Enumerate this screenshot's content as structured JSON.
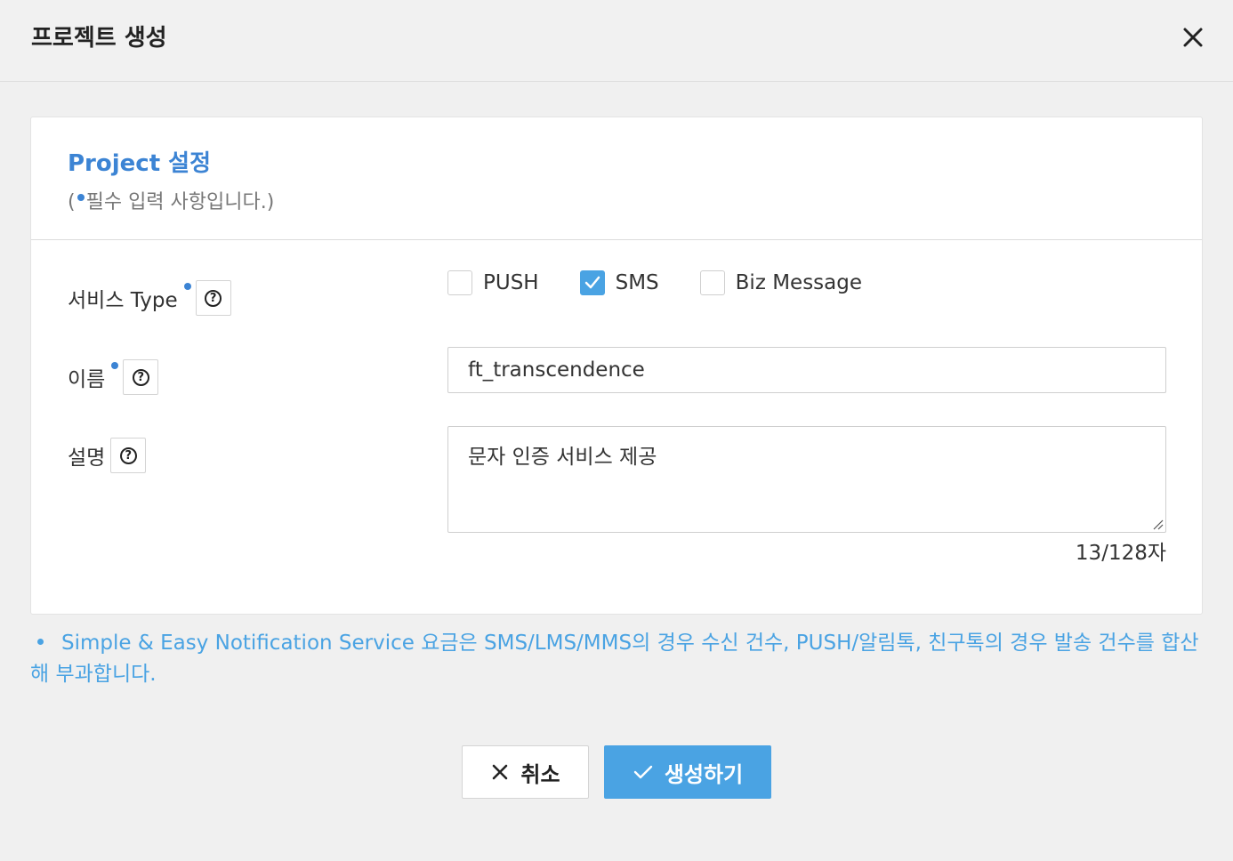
{
  "dialog": {
    "title": "프로젝트 생성",
    "close_icon": "close-icon"
  },
  "card": {
    "title": "Project 설정",
    "required_note_prefix": "(",
    "required_note_text": "필수 입력 사항입니다.)"
  },
  "fields": {
    "service_type": {
      "label": "서비스 Type",
      "required": true,
      "options": [
        {
          "label": "PUSH",
          "checked": false
        },
        {
          "label": "SMS",
          "checked": true
        },
        {
          "label": "Biz Message",
          "checked": false
        }
      ]
    },
    "name": {
      "label": "이름",
      "required": true,
      "value": "ft_transcendence"
    },
    "description": {
      "label": "설명",
      "required": false,
      "value": "문자 인증 서비스 제공",
      "counter": "13/128자"
    }
  },
  "notice": "Simple & Easy Notification Service 요금은 SMS/LMS/MMS의 경우 수신 건수, PUSH/알림톡, 친구톡의 경우 발송 건수를 합산해 부과합니다.",
  "buttons": {
    "cancel": "취소",
    "create": "생성하기"
  },
  "colors": {
    "accent": "#3c84d4",
    "primary_button": "#4aa3e3",
    "notice_text": "#4aa3e3"
  }
}
